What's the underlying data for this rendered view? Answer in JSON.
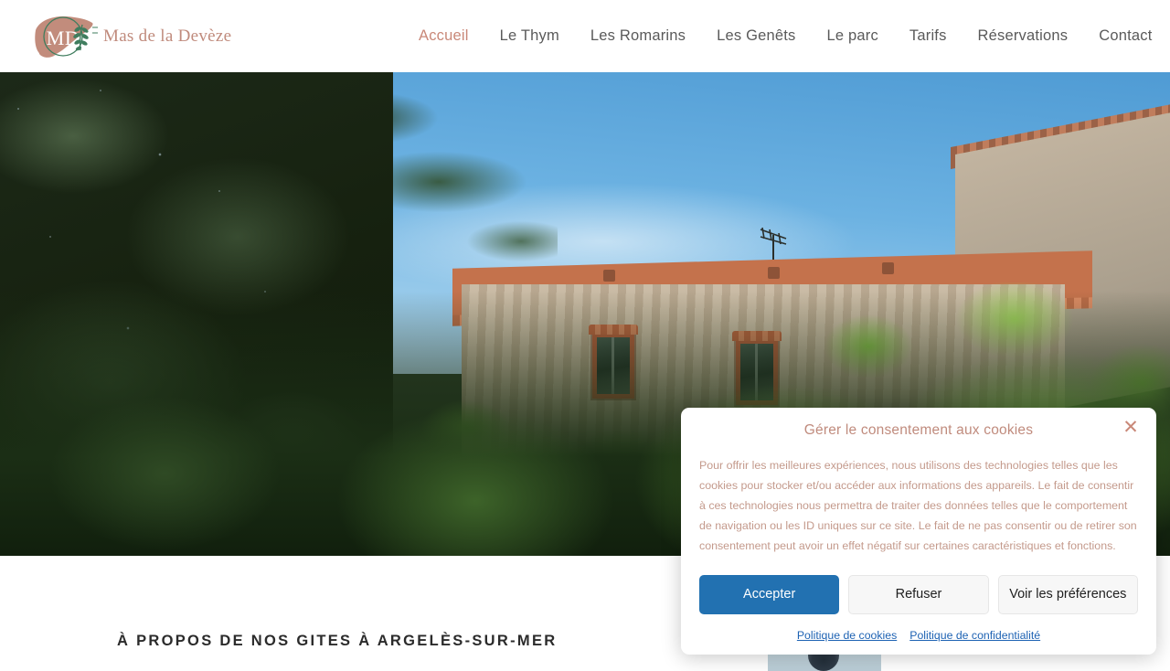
{
  "header": {
    "brand": {
      "monogram": "MD",
      "name": "Mas de la Devèze",
      "emblem_icon": "brushstroke-laurel-logo-icon"
    },
    "nav": [
      {
        "label": "Accueil",
        "active": true
      },
      {
        "label": "Le Thym",
        "active": false
      },
      {
        "label": "Les Romarins",
        "active": false
      },
      {
        "label": "Les Genêts",
        "active": false
      },
      {
        "label": "Le parc",
        "active": false
      },
      {
        "label": "Tarifs",
        "active": false
      },
      {
        "label": "Réservations",
        "active": false
      },
      {
        "label": "Contact",
        "active": false
      }
    ]
  },
  "hero": {
    "alt": "Mas en pierre avec toiture en tuiles, entouré d'arbres et de verdure"
  },
  "main": {
    "section_title": "À propos de nos gites à Argelès-sur-Mer"
  },
  "cookie_dialog": {
    "title": "Gérer le consentement aux cookies",
    "close_label": "✕",
    "body": "Pour offrir les meilleures expériences, nous utilisons des technologies telles que les cookies pour stocker et/ou accéder aux informations des appareils. Le fait de consentir à ces technologies nous permettra de traiter des données telles que le comportement de navigation ou les ID uniques sur ce site. Le fait de ne pas consentir ou de retirer son consentement peut avoir un effet négatif sur certaines caractéristiques et fonctions.",
    "buttons": {
      "accept": "Accepter",
      "refuse": "Refuser",
      "preferences": "Voir les préférences"
    },
    "links": [
      {
        "label": "Politique de cookies"
      },
      {
        "label": "Politique de confidentialité"
      }
    ]
  },
  "colors": {
    "brand_terracotta": "#c08b7d",
    "nav_active": "#c98878",
    "nav_default": "#5a5a5a",
    "accept_button_blue": "#2271b1",
    "link_blue": "#1d62b3",
    "dialog_text": "#c49a8c",
    "heading_dark": "#2b2b2b"
  }
}
